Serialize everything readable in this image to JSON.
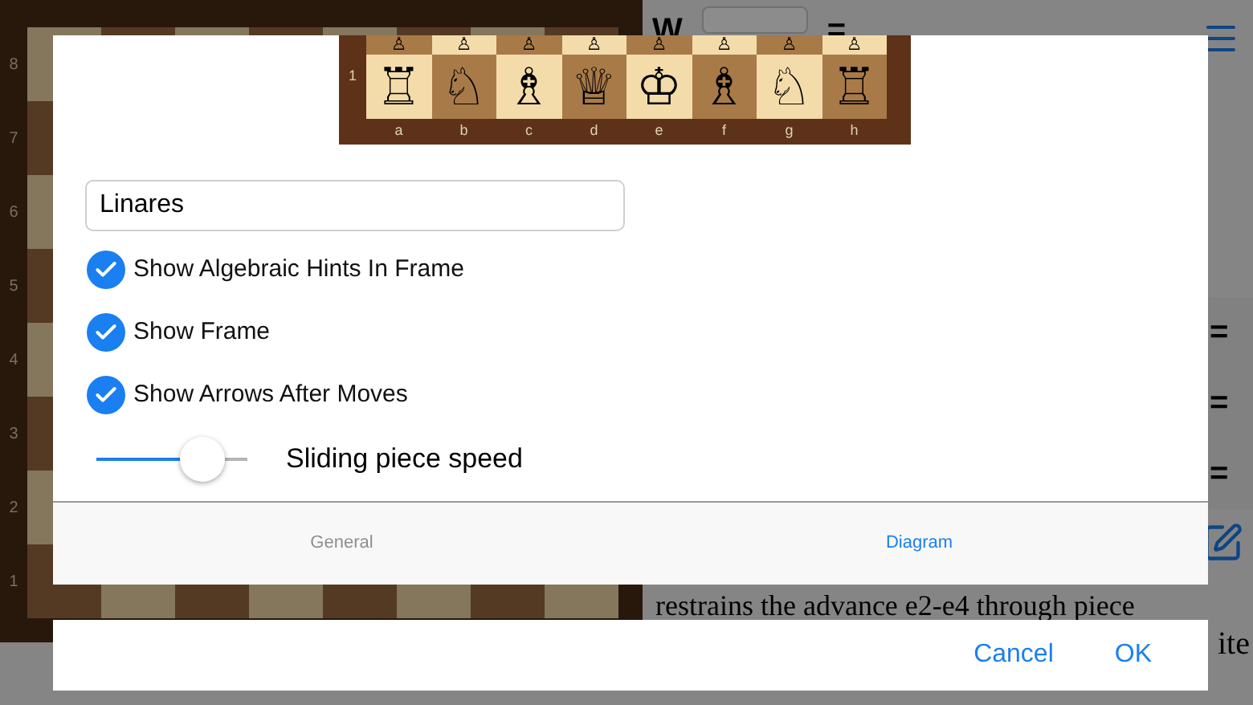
{
  "background": {
    "ranks": [
      "8",
      "7",
      "6",
      "5",
      "4",
      "3",
      "2",
      "1"
    ],
    "side_label": "W",
    "header_mark": "=",
    "row_marks": [
      "=",
      "=",
      "="
    ],
    "notation_text": "restrains the advance e2-e4 through piece",
    "notation_tail": "ite"
  },
  "dialog": {
    "preview": {
      "pawns": [
        "♙",
        "♙",
        "♙",
        "♙",
        "♙",
        "♙",
        "♙",
        "♙"
      ],
      "pieces": [
        "♖",
        "♘",
        "♗",
        "♕",
        "♔",
        "♗",
        "♘",
        "♖"
      ],
      "rank": "1",
      "files": [
        "a",
        "b",
        "c",
        "d",
        "e",
        "f",
        "g",
        "h"
      ]
    },
    "name_field": {
      "value": "Linares"
    },
    "options": [
      {
        "label": "Show Algebraic Hints In Frame",
        "checked": true
      },
      {
        "label": "Show Frame",
        "checked": true
      },
      {
        "label": "Show Arrows After Moves",
        "checked": true
      }
    ],
    "slider": {
      "label": "Sliding piece speed",
      "level": 0.7
    },
    "tabs": [
      {
        "label": "General",
        "selected": false
      },
      {
        "label": "Diagram",
        "selected": true
      }
    ],
    "buttons": [
      {
        "label": "Cancel"
      },
      {
        "label": "OK"
      }
    ]
  }
}
